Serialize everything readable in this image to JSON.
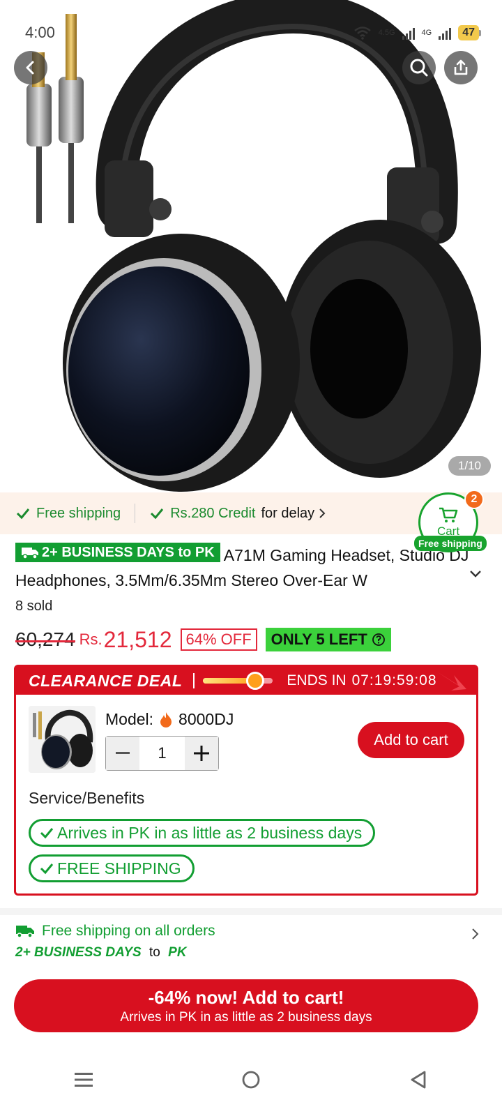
{
  "status_bar": {
    "time": "4:00",
    "net1": "4.5G",
    "net2": "4G",
    "battery": "47"
  },
  "gallery": {
    "counter": "1/10"
  },
  "shipping_strip": {
    "free_shipping": "Free shipping",
    "credit": "Rs.280 Credit",
    "credit_suffix": "for delay"
  },
  "cart": {
    "label": "Cart",
    "count": "2",
    "badge": "Free shipping"
  },
  "product": {
    "delivery_badge": "2+ BUSINESS DAYS to PK",
    "title": "A71M Gaming Headset, Studio DJ Headphones, 3.5Mm/6.35Mm Stereo Over-Ear W",
    "sold": "8 sold",
    "old_price": "60,274",
    "currency": "Rs.",
    "price": "21,512",
    "discount": "64% OFF",
    "stock": "ONLY 5 LEFT"
  },
  "clearance": {
    "title": "CLEARANCE DEAL",
    "ends_label": "ENDS IN",
    "timer": "07:19:59:08",
    "progress": 0.75,
    "model_label": "Model:",
    "model_value": "8000DJ",
    "quantity": "1",
    "add_to_cart": "Add to cart",
    "service_title": "Service/Benefits",
    "benefits": [
      "Arrives in PK in as little as 2 business days",
      "FREE SHIPPING"
    ]
  },
  "shipping_info": {
    "line1": "Free shipping on all orders",
    "line2_a": "2+ BUSINESS DAYS",
    "line2_b": "to",
    "line2_c": "PK"
  },
  "cta": {
    "main": "-64% now! Add to cart!",
    "sub": "Arrives in PK in as little as 2 business days"
  },
  "colors": {
    "accent_red": "#d8101f",
    "green": "#129e32",
    "strip_bg": "#fdf2ea"
  }
}
